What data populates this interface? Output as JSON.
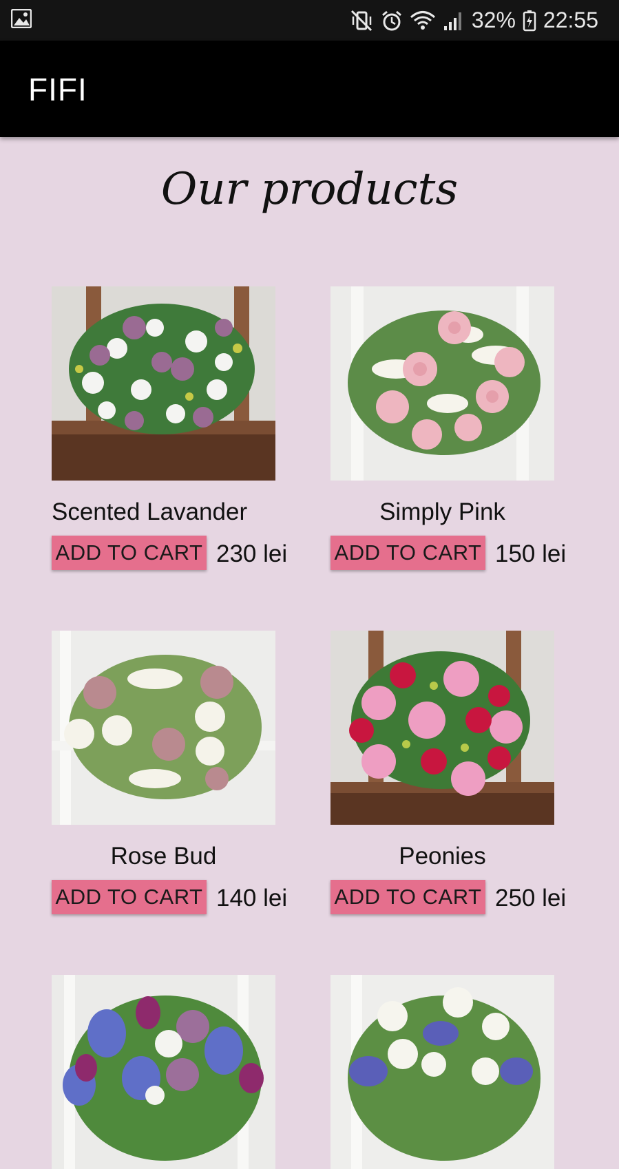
{
  "status_bar": {
    "battery": "32%",
    "time": "22:55",
    "icons": [
      "gallery-icon",
      "mute-vibrate-icon",
      "alarm-icon",
      "wifi-icon",
      "signal-icon",
      "battery-charging-icon"
    ]
  },
  "app_bar": {
    "title": "FIFI",
    "background": "#000000"
  },
  "page": {
    "heading": "Our products",
    "background": "#e6d6e2"
  },
  "accent": "#e56f8d",
  "products": [
    {
      "name": "Scented Lavander",
      "price": "230 lei",
      "button": "ADD TO CART"
    },
    {
      "name": "Simply Pink",
      "price": "150 lei",
      "button": "ADD TO CART"
    },
    {
      "name": "Rose Bud",
      "price": "140 lei",
      "button": "ADD TO CART"
    },
    {
      "name": "Peonies",
      "price": "250 lei",
      "button": "ADD TO CART"
    },
    {
      "name": "",
      "price": "",
      "button": ""
    },
    {
      "name": "",
      "price": "",
      "button": ""
    }
  ]
}
